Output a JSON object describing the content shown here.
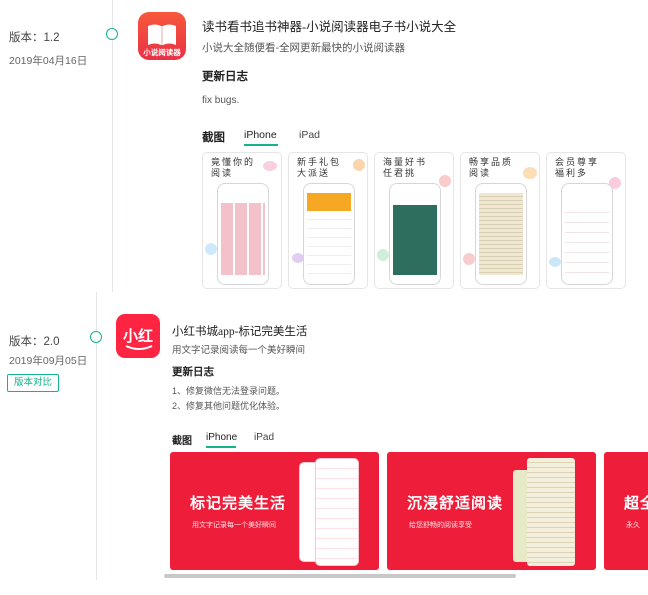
{
  "entries": [
    {
      "version": "版本：1.2",
      "date": "2019年04月16日",
      "app_title": "读书看书追书神器-小说阅读器电子书小说大全",
      "app_subtitle": "小说大全随便看-全网更新最快的小说阅读器",
      "icon_text": "小说阅读器",
      "changelog_heading": "更新日志",
      "changelog": [
        "fix bugs."
      ],
      "screens_label": "截图",
      "tabs": [
        "iPhone",
        "iPad"
      ],
      "screenshots": [
        {
          "caption": [
            "竟懂你的",
            "阅读"
          ]
        },
        {
          "caption": [
            "新手礼包",
            "大派送"
          ]
        },
        {
          "caption": [
            "海量好书",
            "任君挑"
          ]
        },
        {
          "caption": [
            "畅享品质",
            "阅读"
          ]
        },
        {
          "caption": [
            "会员尊享",
            "福利多"
          ]
        }
      ]
    },
    {
      "version": "版本：2.0",
      "date": "2019年09月05日",
      "compare_label": "版本对比",
      "app_title": "小红书城app-标记完美生活",
      "app_subtitle": "用文字记录阅读每一个美好瞬间",
      "icon_text": "小红",
      "changelog_heading": "更新日志",
      "changelog": [
        "1、修复微信无法登录问题。",
        "2、修复其他问题优化体验。"
      ],
      "screens_label": "截图",
      "tabs": [
        "iPhone",
        "iPad"
      ],
      "cards": [
        {
          "title": "标记完美生活",
          "sub": "用文字记录每一个美好瞬间"
        },
        {
          "title": "沉浸舒适阅读",
          "sub": "给您舒畅的阅读享受"
        },
        {
          "title": "超全",
          "sub": "永久"
        }
      ]
    }
  ],
  "colors": {
    "accent": "#14b38c",
    "brand_red": "#ee1d3a"
  }
}
